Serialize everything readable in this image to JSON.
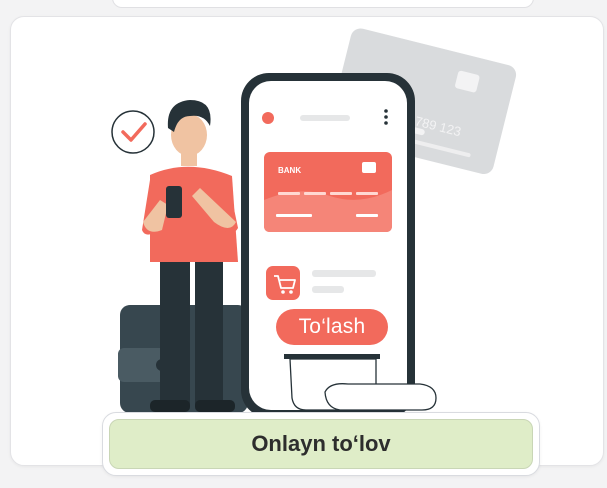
{
  "phone": {
    "card_bank_label": "BANK",
    "pay_button_label": "To‘lash"
  },
  "cta": {
    "label": "Onlayn to‘lov"
  },
  "colors": {
    "accent_red": "#f26a5c",
    "cta_green": "#dfedc8",
    "dark_navy": "#263238",
    "background": "#f3f3f4",
    "card_gray": "#d6d8da"
  },
  "icons": [
    "checkmark-icon",
    "cart-icon",
    "menu-dots-icon",
    "wallet-icon",
    "credit-card-icon",
    "receipt-icon"
  ]
}
